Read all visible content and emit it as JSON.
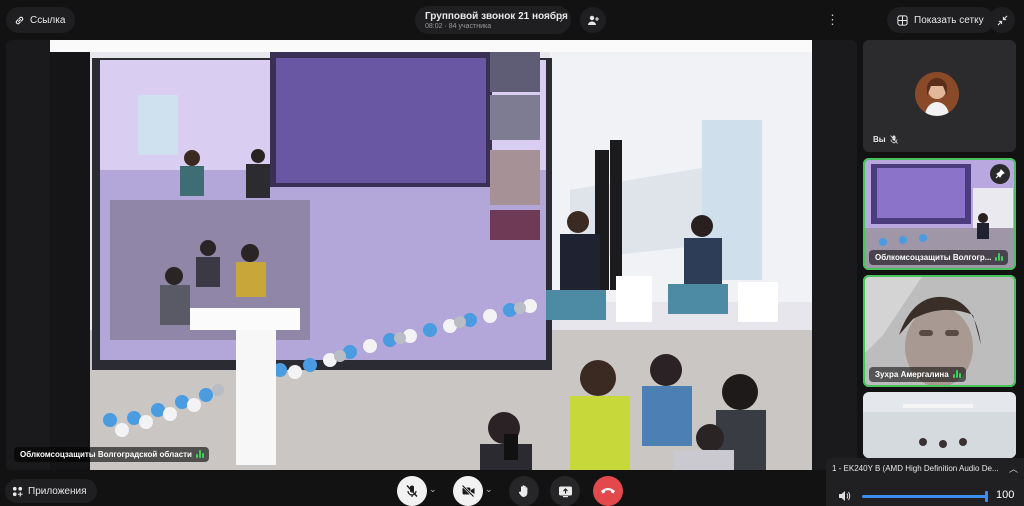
{
  "topbar": {
    "link_label": "Ссылка",
    "call_title": "Групповой звонок 21 ноября",
    "call_meta": "08:02 · 84 участника",
    "grid_label": "Показать сетку"
  },
  "main": {
    "speaker_name": "Облкомсоцзащиты Волгоградской области"
  },
  "sidebar": {
    "self_label": "Вы",
    "tiles": [
      {
        "name": "Облкомсоцзащиты Волгогр..."
      },
      {
        "name": "Зухра Амергалина"
      }
    ]
  },
  "bottombar": {
    "apps_label": "Приложения"
  },
  "audio": {
    "device": "1 - EK240Y B (AMD High Definition Audio De...",
    "volume": 100,
    "volume_label": "100"
  },
  "colors": {
    "accent": "#3b8df0",
    "active_border": "#48c25a",
    "hangup": "#e2484c"
  }
}
